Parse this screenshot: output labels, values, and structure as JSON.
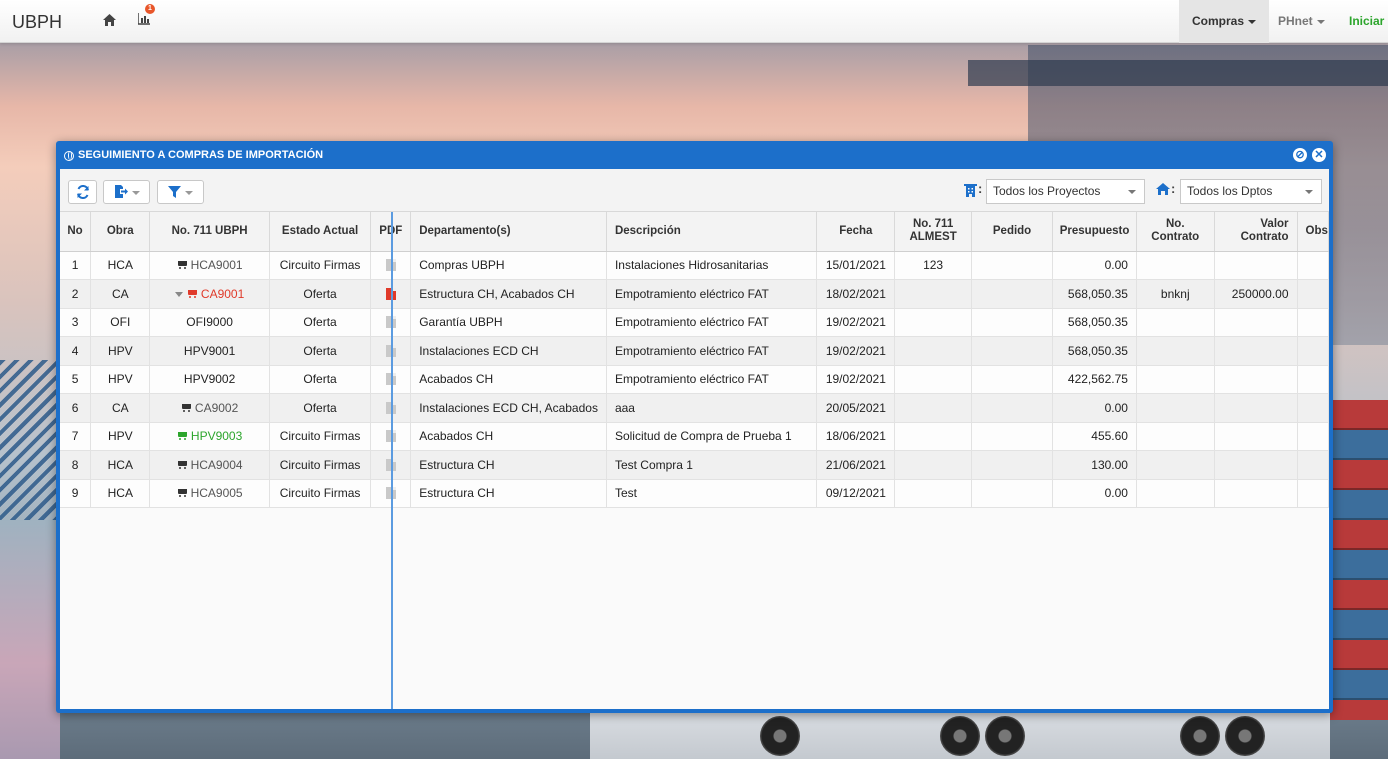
{
  "navbar": {
    "brand": "UBPH",
    "badge_count": "1",
    "menus": [
      {
        "label": "Compras",
        "active": true
      },
      {
        "label": "PHnet",
        "active": false
      }
    ],
    "login_label": "Iniciar S"
  },
  "window": {
    "title": "SEGUIMIENTO A COMPRAS DE IMPORTACIÓN",
    "project_select": "Todos los Proyectos",
    "dept_select": "Todos los Dptos",
    "colon": ":"
  },
  "columns": {
    "no": "No",
    "obra": "Obra",
    "no711": "No. 711 UBPH",
    "estado": "Estado Actual",
    "pdf": "PDF",
    "depto": "Departamento(s)",
    "desc": "Descripción",
    "fecha": "Fecha",
    "almest_1": "No. 711",
    "almest_2": "ALMEST",
    "pedido": "Pedido",
    "presupuesto": "Presupuesto",
    "contrato_1": "No.",
    "contrato_2": "Contrato",
    "valor_1": "Valor",
    "valor_2": "Contrato",
    "obs": "Obs"
  },
  "rows": [
    {
      "no": "1",
      "obra": "HCA",
      "code": "HCA9001",
      "cart": true,
      "cart_color": "#333333",
      "code_color": "#555555",
      "expand": false,
      "estado": "Circuito Firmas",
      "pdf_red": false,
      "depto": "Compras UBPH",
      "desc": "Instalaciones Hidrosanitarias",
      "fecha": "15/01/2021",
      "almest": "123",
      "pedido": "",
      "presupuesto": "0.00",
      "contrato": "",
      "valor": "",
      "obs": ""
    },
    {
      "no": "2",
      "obra": "CA",
      "code": "CA9001",
      "cart": true,
      "cart_color": "#e03a2a",
      "code_color": "#e03a2a",
      "expand": true,
      "estado": "Oferta",
      "pdf_red": true,
      "depto": "Estructura CH, Acabados CH",
      "desc": "Empotramiento eléctrico FAT",
      "fecha": "18/02/2021",
      "almest": "",
      "pedido": "",
      "presupuesto": "568,050.35",
      "contrato": "bnknj",
      "valor": "250000.00",
      "obs": ""
    },
    {
      "no": "3",
      "obra": "OFI",
      "code": "OFI9000",
      "cart": false,
      "cart_color": "#333333",
      "code_color": "#222222",
      "expand": false,
      "estado": "Oferta",
      "pdf_red": false,
      "depto": "Garantía UBPH",
      "desc": "Empotramiento eléctrico FAT",
      "fecha": "19/02/2021",
      "almest": "",
      "pedido": "",
      "presupuesto": "568,050.35",
      "contrato": "",
      "valor": "",
      "obs": ""
    },
    {
      "no": "4",
      "obra": "HPV",
      "code": "HPV9001",
      "cart": false,
      "cart_color": "#333333",
      "code_color": "#222222",
      "expand": false,
      "estado": "Oferta",
      "pdf_red": false,
      "depto": "Instalaciones ECD CH",
      "desc": "Empotramiento eléctrico FAT",
      "fecha": "19/02/2021",
      "almest": "",
      "pedido": "",
      "presupuesto": "568,050.35",
      "contrato": "",
      "valor": "",
      "obs": ""
    },
    {
      "no": "5",
      "obra": "HPV",
      "code": "HPV9002",
      "cart": false,
      "cart_color": "#333333",
      "code_color": "#222222",
      "expand": false,
      "estado": "Oferta",
      "pdf_red": false,
      "depto": "Acabados CH",
      "desc": "Empotramiento eléctrico FAT",
      "fecha": "19/02/2021",
      "almest": "",
      "pedido": "",
      "presupuesto": "422,562.75",
      "contrato": "",
      "valor": "",
      "obs": ""
    },
    {
      "no": "6",
      "obra": "CA",
      "code": "CA9002",
      "cart": true,
      "cart_color": "#333333",
      "code_color": "#555555",
      "expand": false,
      "estado": "Oferta",
      "pdf_red": false,
      "depto": "Instalaciones ECD CH, Acabados",
      "desc": "aaa",
      "fecha": "20/05/2021",
      "almest": "",
      "pedido": "",
      "presupuesto": "0.00",
      "contrato": "",
      "valor": "",
      "obs": ""
    },
    {
      "no": "7",
      "obra": "HPV",
      "code": "HPV9003",
      "cart": true,
      "cart_color": "#2ca52c",
      "code_color": "#2ca52c",
      "expand": false,
      "estado": "Circuito Firmas",
      "pdf_red": false,
      "depto": "Acabados CH",
      "desc": "Solicitud de Compra de Prueba 1",
      "fecha": "18/06/2021",
      "almest": "",
      "pedido": "",
      "presupuesto": "455.60",
      "contrato": "",
      "valor": "",
      "obs": ""
    },
    {
      "no": "8",
      "obra": "HCA",
      "code": "HCA9004",
      "cart": true,
      "cart_color": "#333333",
      "code_color": "#555555",
      "expand": false,
      "estado": "Circuito Firmas",
      "pdf_red": false,
      "depto": "Estructura CH",
      "desc": "Test Compra 1",
      "fecha": "21/06/2021",
      "almest": "",
      "pedido": "",
      "presupuesto": "130.00",
      "contrato": "",
      "valor": "",
      "obs": ""
    },
    {
      "no": "9",
      "obra": "HCA",
      "code": "HCA9005",
      "cart": true,
      "cart_color": "#333333",
      "code_color": "#555555",
      "expand": false,
      "estado": "Circuito Firmas",
      "pdf_red": false,
      "depto": "Estructura CH",
      "desc": "Test",
      "fecha": "09/12/2021",
      "almest": "",
      "pedido": "",
      "presupuesto": "0.00",
      "contrato": "",
      "valor": "",
      "obs": ""
    }
  ]
}
